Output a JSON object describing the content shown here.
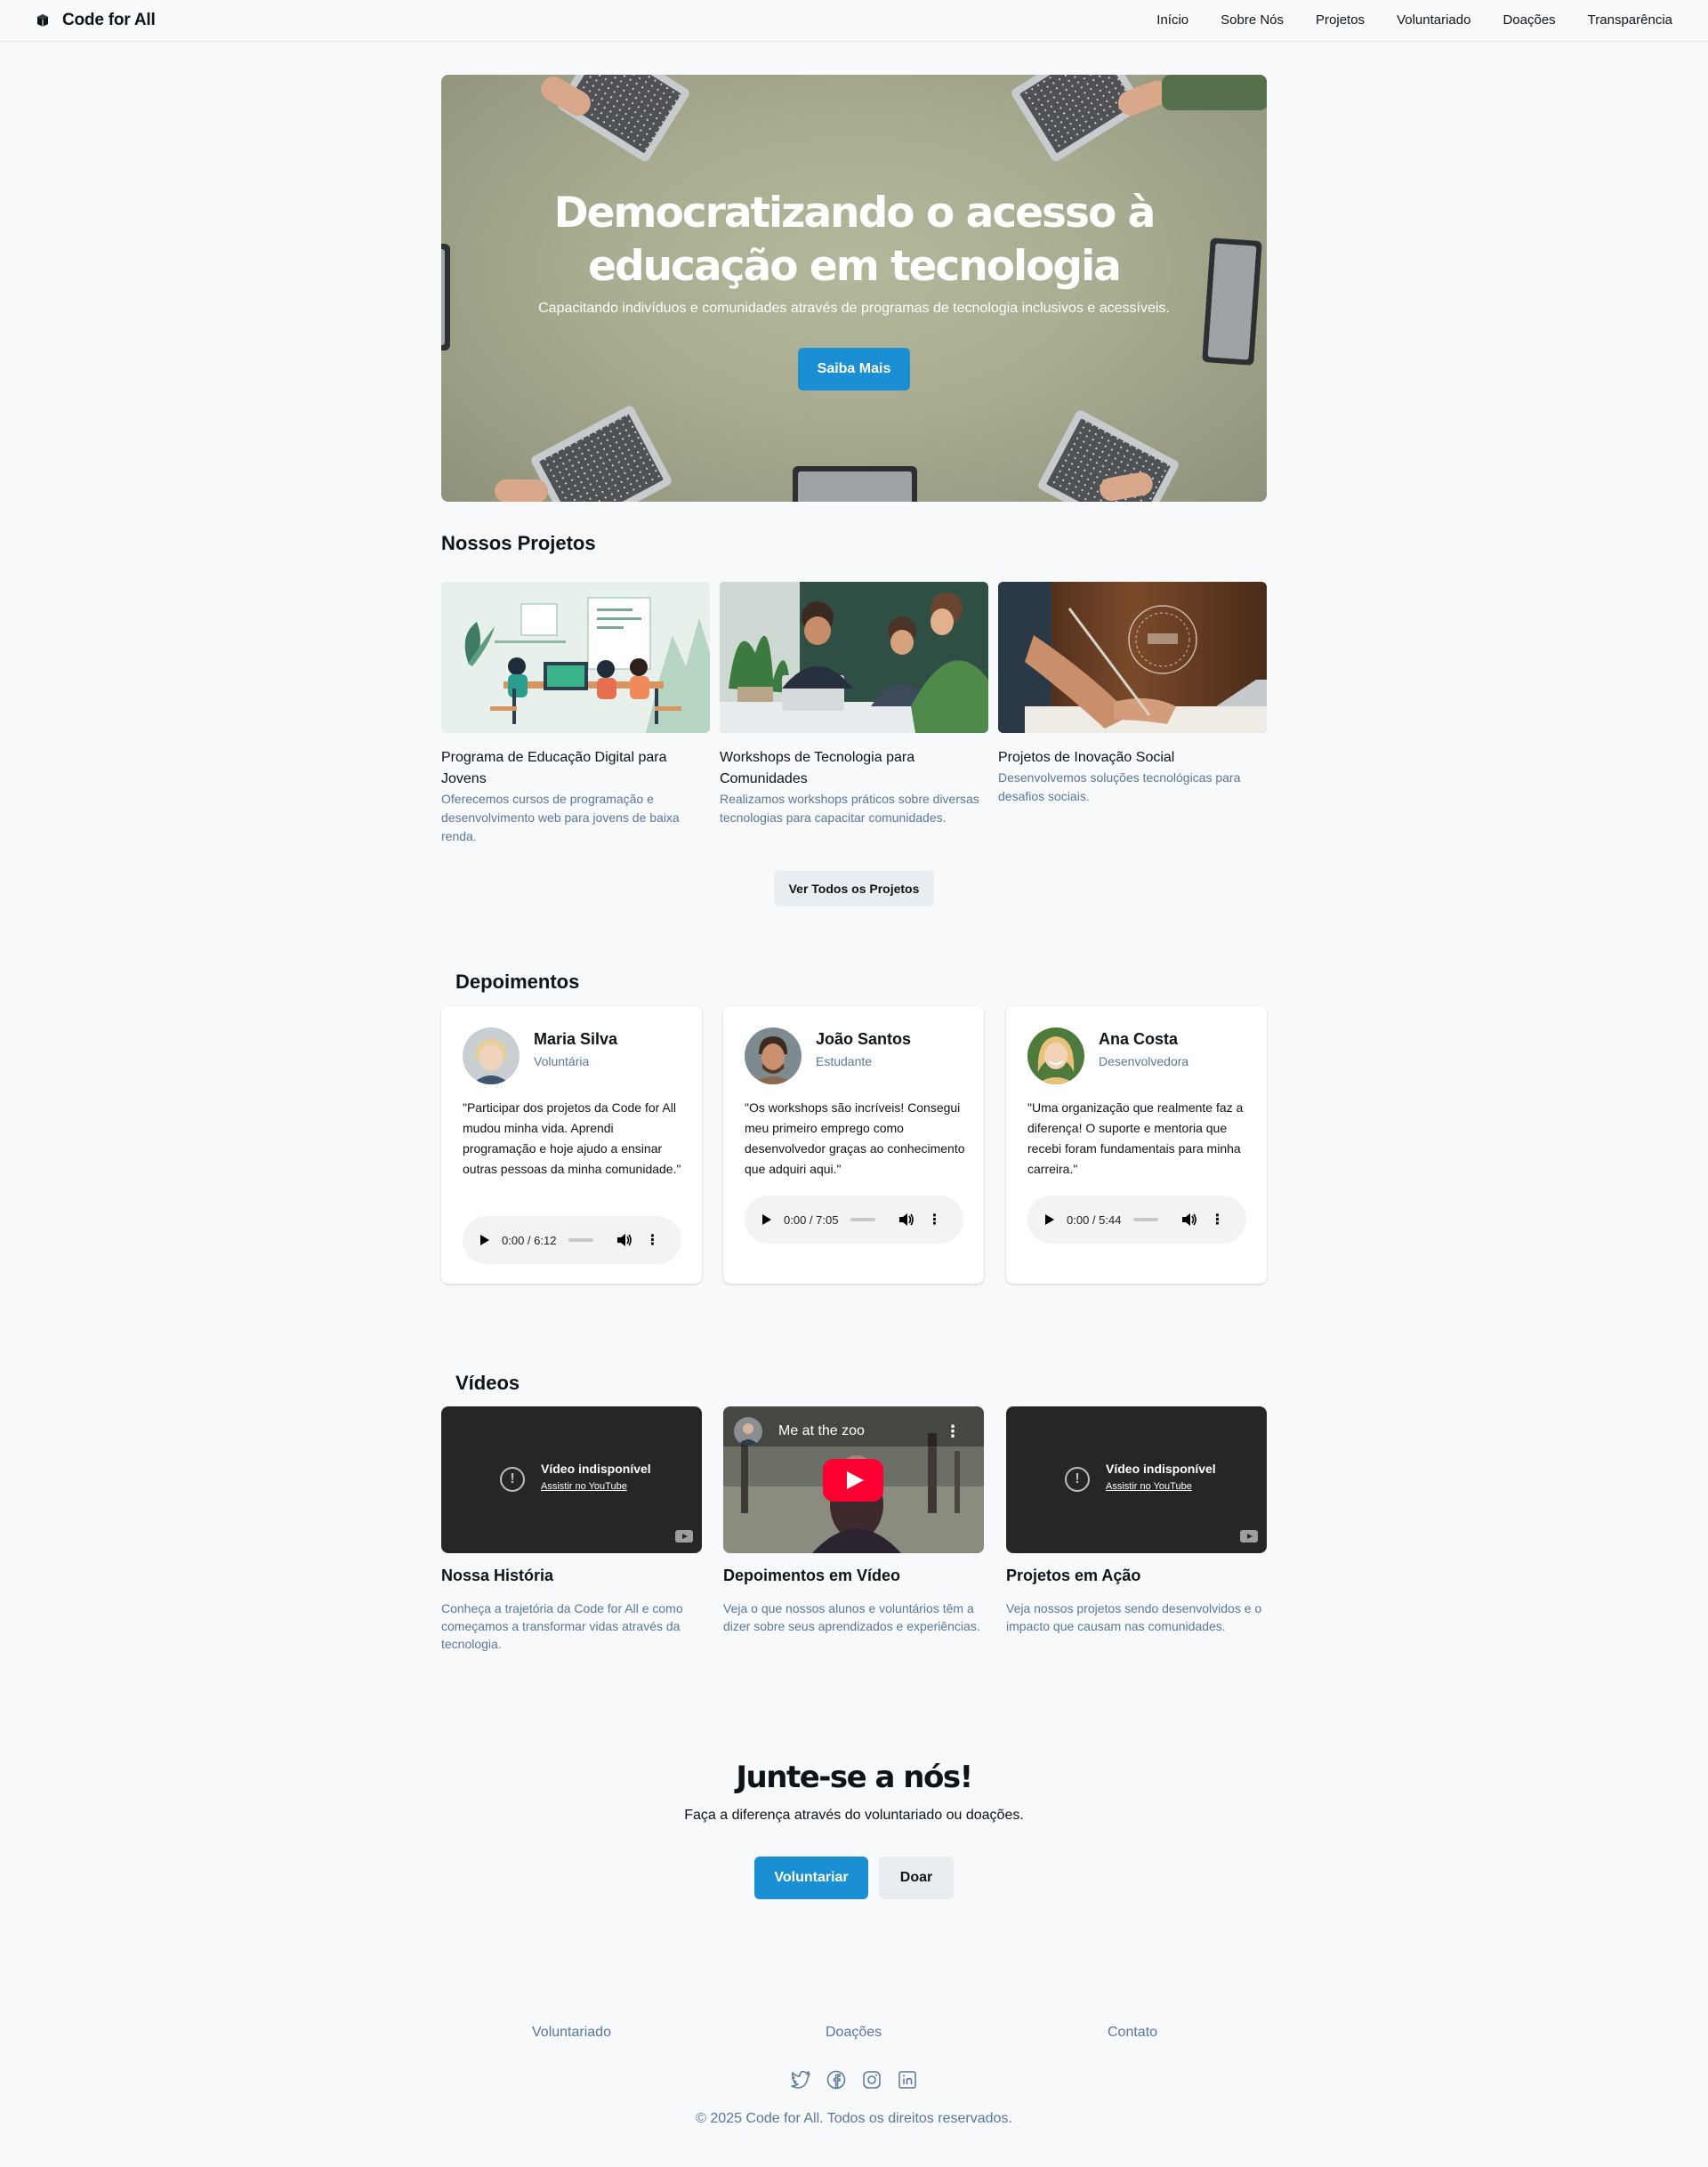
{
  "header": {
    "brand": "Code for All",
    "nav": [
      "Início",
      "Sobre Nós",
      "Projetos",
      "Voluntariado",
      "Doações",
      "Transparência"
    ]
  },
  "hero": {
    "title": "Democratizando o acesso à educação em tecnologia",
    "subtitle": "Capacitando indivíduos e comunidades através de programas de tecnologia inclusivos e acessíveis.",
    "button": "Saiba Mais"
  },
  "projects": {
    "title": "Nossos Projetos",
    "items": [
      {
        "name": "Programa de Educação Digital para Jovens",
        "desc": "Oferecemos cursos de programação e desenvolvimento web para jovens de baixa renda."
      },
      {
        "name": "Workshops de Tecnologia para Comunidades",
        "desc": "Realizamos workshops práticos sobre diversas tecnologias para capacitar comunidades."
      },
      {
        "name": "Projetos de Inovação Social",
        "desc": "Desenvolvemos soluções tecnológicas para desafios sociais."
      }
    ],
    "button": "Ver Todos os Projetos"
  },
  "testimonials": {
    "title": "Depoimentos",
    "items": [
      {
        "name": "Maria Silva",
        "role": "Voluntária",
        "quote": "\"Participar dos projetos da Code for All mudou minha vida. Aprendi programação e hoje ajudo a ensinar outras pessoas da minha comunidade.\"",
        "time": "0:00 / 6:12"
      },
      {
        "name": "João Santos",
        "role": "Estudante",
        "quote": "\"Os workshops são incríveis! Consegui meu primeiro emprego como desenvolvedor graças ao conhecimento que adquiri aqui.\"",
        "time": "0:00 / 7:05"
      },
      {
        "name": "Ana Costa",
        "role": "Desenvolvedora",
        "quote": "\"Uma organização que realmente faz a diferença! O suporte e mentoria que recebi foram fundamentais para minha carreira.\"",
        "time": "0:00 / 5:44"
      }
    ]
  },
  "videos": {
    "title": "Vídeos",
    "unavailable": "Vídeo indisponível",
    "watch": "Assistir no YouTube",
    "embed_title": "Me at the zoo",
    "items": [
      {
        "name": "Nossa História",
        "desc": "Conheça a trajetória da Code for All e como começamos a transformar vidas através da tecnologia."
      },
      {
        "name": "Depoimentos em Vídeo",
        "desc": "Veja o que nossos alunos e voluntários têm a dizer sobre seus aprendizados e experiências."
      },
      {
        "name": "Projetos em Ação",
        "desc": "Veja nossos projetos sendo desenvolvidos e o impacto que causam nas comunidades."
      }
    ]
  },
  "join": {
    "title": "Junte-se a nós!",
    "subtitle": "Faça a diferença através do voluntariado ou doações.",
    "volunteer": "Voluntariar",
    "donate": "Doar"
  },
  "footer": {
    "links": [
      "Voluntariado",
      "Doações",
      "Contato"
    ],
    "social": [
      "twitter-icon",
      "facebook-icon",
      "instagram-icon",
      "linkedin-icon"
    ],
    "copyright": "© 2025 Code for All. Todos os direitos reservados."
  },
  "colors": {
    "accent": "#1b8fd3",
    "muted": "#5b7896",
    "youtube_red": "#ff0033"
  }
}
